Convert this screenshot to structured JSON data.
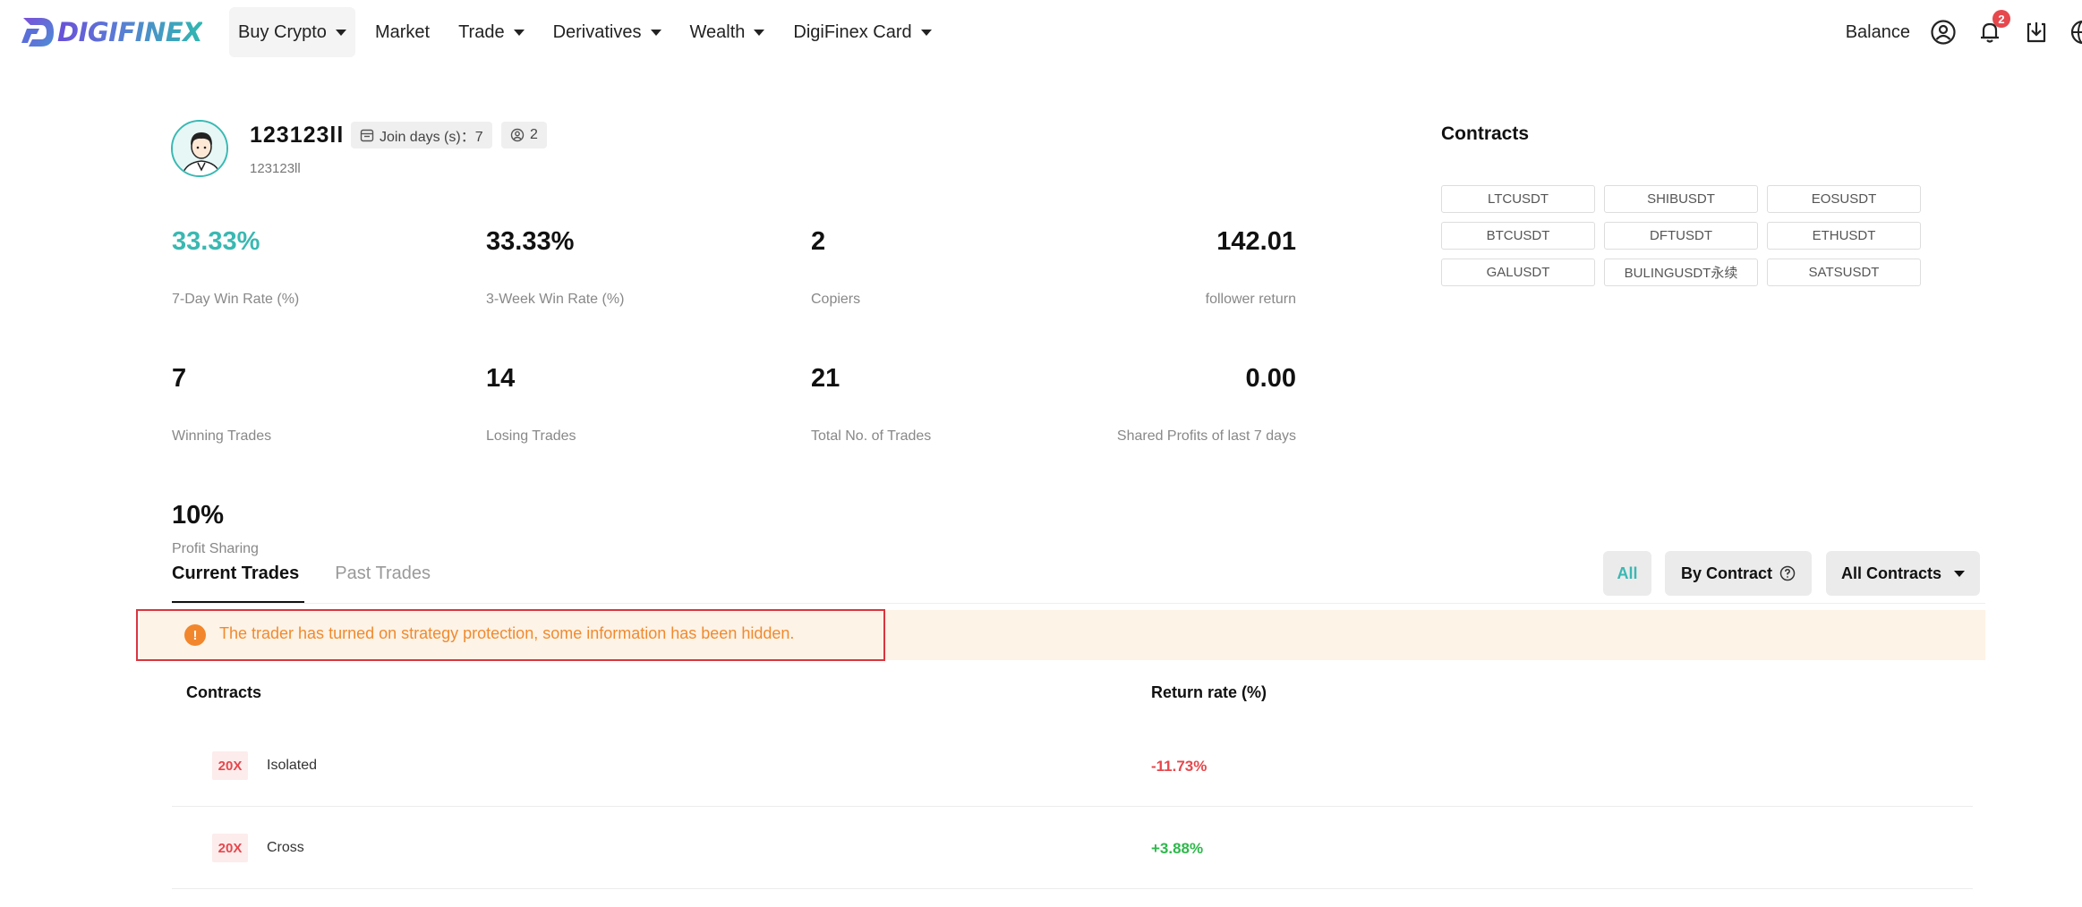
{
  "brand": {
    "name": "DIGIFINEX"
  },
  "nav": {
    "items": [
      {
        "label": "Buy Crypto",
        "dropdown": true
      },
      {
        "label": "Market",
        "dropdown": false
      },
      {
        "label": "Trade",
        "dropdown": true
      },
      {
        "label": "Derivatives",
        "dropdown": true
      },
      {
        "label": "Wealth",
        "dropdown": true
      },
      {
        "label": "DigiFinex Card",
        "dropdown": true
      }
    ],
    "balance_label": "Balance",
    "notification_count": "2"
  },
  "profile": {
    "username": "123123ll",
    "sub_username": "123123ll",
    "join_days_label": "Join days (s)：7",
    "copiers_count": "2"
  },
  "stats": [
    {
      "value": "33.33%",
      "label": "7-Day Win Rate (%)",
      "highlight": true
    },
    {
      "value": "33.33%",
      "label": "3-Week Win Rate (%)"
    },
    {
      "value": "2",
      "label": "Copiers"
    },
    {
      "value": "142.01",
      "label": "follower return"
    },
    {
      "value": "7",
      "label": "Winning Trades"
    },
    {
      "value": "14",
      "label": "Losing Trades"
    },
    {
      "value": "21",
      "label": "Total No. of Trades"
    },
    {
      "value": "0.00",
      "label": "Shared Profits of last 7 days"
    },
    {
      "value": "10%",
      "label": "Profit Sharing"
    }
  ],
  "contracts_panel": {
    "title": "Contracts",
    "tags": [
      "LTCUSDT",
      "SHIBUSDT",
      "EOSUSDT",
      "BTCUSDT",
      "DFTUSDT",
      "ETHUSDT",
      "GALUSDT",
      "BULINGUSDT永续",
      "SATSUSDT"
    ]
  },
  "tabs": [
    {
      "label": "Current Trades",
      "active": true
    },
    {
      "label": "Past Trades",
      "active": false
    }
  ],
  "filters": {
    "all_label": "All",
    "by_contract_label": "By Contract",
    "all_contracts_label": "All Contracts"
  },
  "notice": {
    "text": "The trader has turned on strategy protection, some information has been hidden."
  },
  "table": {
    "headers": {
      "contracts": "Contracts",
      "return_rate": "Return rate (%)"
    },
    "rows": [
      {
        "leverage": "20X",
        "mode": "Isolated",
        "return_rate": "-11.73%",
        "direction": "negative"
      },
      {
        "leverage": "20X",
        "mode": "Cross",
        "return_rate": "+3.88%",
        "direction": "positive"
      }
    ]
  },
  "colors": {
    "accent": "#3ab8b2",
    "negative": "#e5484d",
    "positive": "#2eb84b",
    "notice_bg": "#fdf3e6",
    "notice_text": "#f08a2f"
  }
}
